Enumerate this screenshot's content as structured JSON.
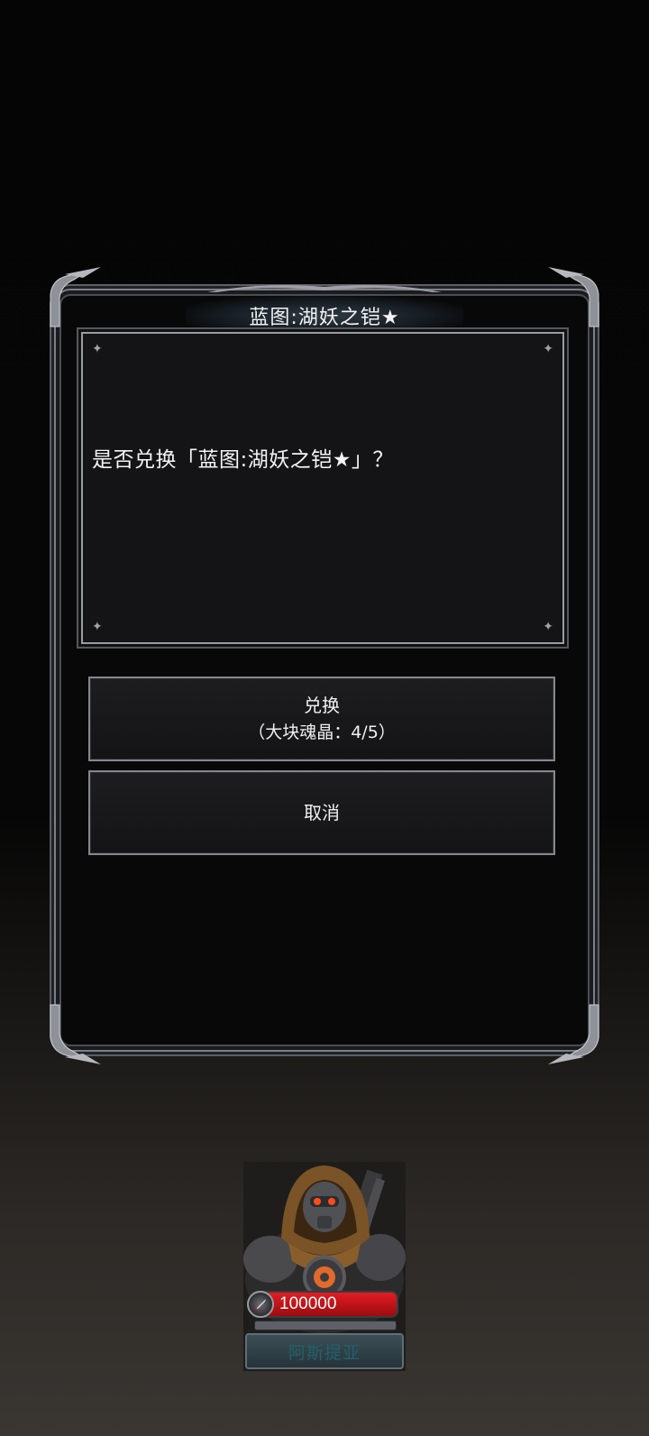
{
  "dialog": {
    "title": "蓝图:湖妖之铠★",
    "message": "是否兑换「蓝图:湖妖之铠★」？",
    "buttons": {
      "exchange_label": "兑换",
      "exchange_sub": "（大块魂晶：4/5）",
      "cancel_label": "取消"
    }
  },
  "character": {
    "hp_value": "100000",
    "name": "阿斯提亚"
  },
  "icons": {
    "sparkle": "sparkle-icon",
    "hp": "blade-icon"
  }
}
